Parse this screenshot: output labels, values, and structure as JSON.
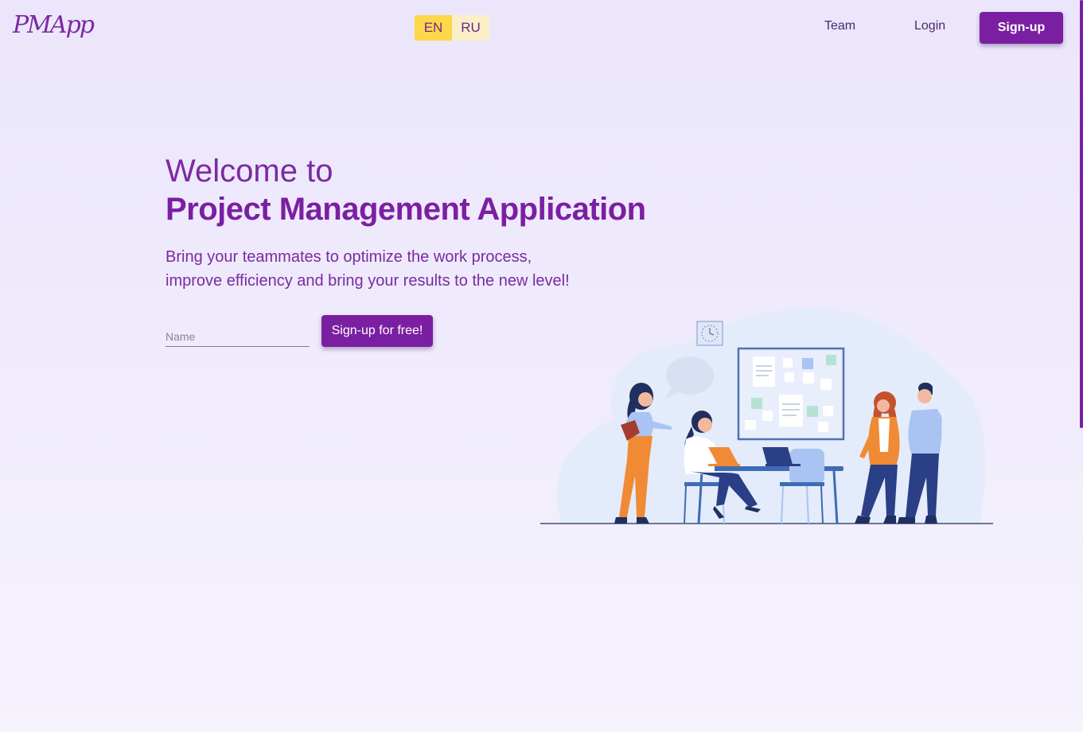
{
  "header": {
    "logo": "PMApp",
    "languages": [
      "EN",
      "RU"
    ],
    "nav": {
      "team": "Team",
      "login": "Login",
      "signup": "Sign-up"
    }
  },
  "hero": {
    "welcome": "Welcome to",
    "title": "Project Management Application",
    "subtitle_line1": "Bring your teammates to optimize the work process,",
    "subtitle_line2": "improve efficiency and bring your results to the new level!",
    "name_placeholder": "Name",
    "cta": "Sign-up for free!"
  },
  "colors": {
    "primary": "#7b1fa2",
    "lang_active": "#fcd84a",
    "lang_inactive": "#fbefc8",
    "background": "#ebe6fb"
  }
}
